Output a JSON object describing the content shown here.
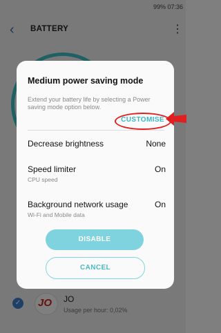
{
  "statusbar": {
    "left": "",
    "right": "99% 07:36"
  },
  "appbar": {
    "title": "BATTERY"
  },
  "dialog": {
    "title": "Medium power saving mode",
    "description": "Extend your battery life by selecting a Power saving mode option below.",
    "customise_label": "CUSTOMISE",
    "options": [
      {
        "label": "Decrease brightness",
        "sublabel": "",
        "value": "None"
      },
      {
        "label": "Speed limiter",
        "sublabel": "CPU speed",
        "value": "On"
      },
      {
        "label": "Background network usage",
        "sublabel": "Wi-Fi and Mobile data",
        "value": "On"
      }
    ],
    "disable_label": "DISABLE",
    "cancel_label": "CANCEL"
  },
  "app": {
    "name": "JO",
    "usage": "Usage per hour: 0,02%",
    "logo_text": "JO"
  },
  "colors": {
    "accent": "#3ab8c6",
    "highlight": "#e02020"
  }
}
